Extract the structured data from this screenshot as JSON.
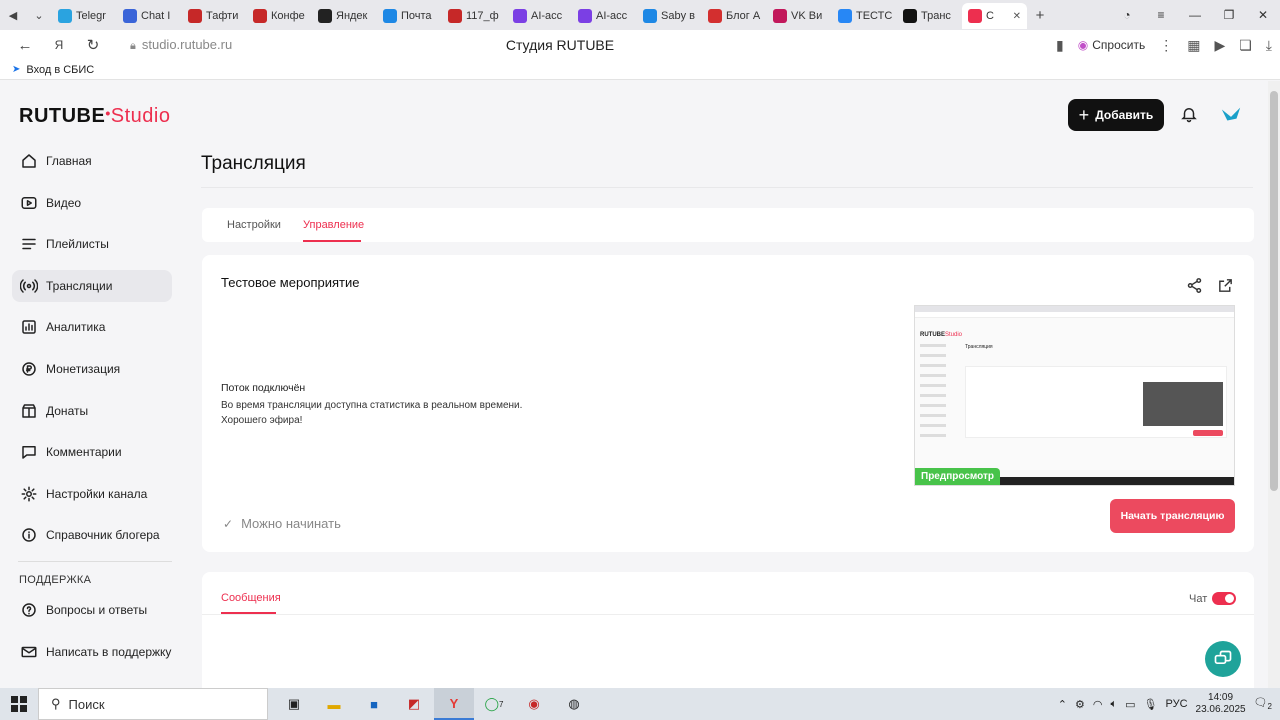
{
  "browser": {
    "tabs": [
      {
        "label": "Telegr",
        "color": "#2aa3e0"
      },
      {
        "label": "Chat I",
        "color": "#3a64d8"
      },
      {
        "label": "Тафти",
        "color": "#c62828"
      },
      {
        "label": "Конфе",
        "color": "#c62828"
      },
      {
        "label": "Яндек",
        "color": "#222222"
      },
      {
        "label": "Почта",
        "color": "#1e88e5"
      },
      {
        "label": "117_ф",
        "color": "#c62828"
      },
      {
        "label": "AI-асс",
        "color": "#7b3fe4"
      },
      {
        "label": "AI-асс",
        "color": "#7b3fe4"
      },
      {
        "label": "Saby в",
        "color": "#1e88e5"
      },
      {
        "label": "Блог А",
        "color": "#d32f2f"
      },
      {
        "label": "VK Ви",
        "color": "#c2185b"
      },
      {
        "label": "ТЕСТС",
        "color": "#2787f5"
      },
      {
        "label": "Транс",
        "color": "#111111"
      },
      {
        "label": "С",
        "color": "#ed2f4f"
      }
    ],
    "address": "studio.rutube.ru",
    "page_title": "Студия RUTUBE",
    "ask_label": "Спросить",
    "bookmark": "Вход в СБИС"
  },
  "header": {
    "logo_main": "RUTUBE",
    "logo_studio": "Studio",
    "add_label": "Добавить"
  },
  "sidebar": {
    "items": [
      {
        "label": "Главная",
        "icon": "home-icon"
      },
      {
        "label": "Видео",
        "icon": "video-icon"
      },
      {
        "label": "Плейлисты",
        "icon": "playlist-icon"
      },
      {
        "label": "Трансляции",
        "icon": "broadcast-icon"
      },
      {
        "label": "Аналитика",
        "icon": "analytics-icon"
      },
      {
        "label": "Монетизация",
        "icon": "monetization-icon"
      },
      {
        "label": "Донаты",
        "icon": "donation-icon"
      },
      {
        "label": "Комментарии",
        "icon": "comments-icon"
      },
      {
        "label": "Настройки канала",
        "icon": "gear-icon"
      },
      {
        "label": "Справочник блогера",
        "icon": "info-icon"
      }
    ],
    "support_heading": "ПОДДЕРЖКА",
    "support_items": [
      {
        "label": "Вопросы и ответы",
        "icon": "help-icon"
      },
      {
        "label": "Написать в поддержку",
        "icon": "mail-icon"
      }
    ]
  },
  "main": {
    "title": "Трансляция",
    "tabs": [
      {
        "label": "Настройки"
      },
      {
        "label": "Управление"
      }
    ],
    "event": {
      "title": "Тестовое мероприятие",
      "status_heading": "Поток подключён",
      "status_line1": "Во время трансляции доступна статистика в реальном времени.",
      "status_line2": "Хорошего эфира!",
      "preview_label": "Предпросмотр",
      "ready_label": "Можно начинать",
      "start_label": "Начать трансляцию"
    },
    "messages": {
      "tab_label": "Сообщения",
      "chat_label": "Чат",
      "chat_enabled": true
    }
  },
  "taskbar": {
    "search_label": "Поиск",
    "lang": "РУС",
    "time": "14:09",
    "date": "23.06.2025",
    "whatsapp_badge": "7",
    "notif_count": "2"
  }
}
